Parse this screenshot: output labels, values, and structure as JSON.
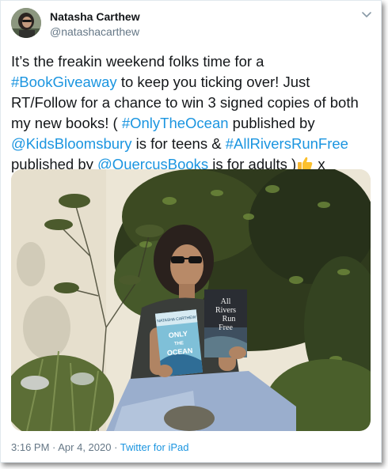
{
  "tweet": {
    "user": {
      "name": "Natasha Carthew",
      "handle": "@natashacarthew"
    },
    "lines": [
      [
        {
          "t": "It’s the freakin weekend folks time for a",
          "link": false
        }
      ],
      [
        {
          "t": "#BookGiveaway",
          "link": true
        },
        {
          "t": " to keep you ticking over! Just",
          "link": false
        }
      ],
      [
        {
          "t": "RT/Follow for a chance to win 3 signed copies of both",
          "link": false
        }
      ],
      [
        {
          "t": "my new books! ( ",
          "link": false
        },
        {
          "t": "#OnlyTheOcean",
          "link": true
        },
        {
          "t": " published by",
          "link": false
        }
      ],
      [
        {
          "t": "@KidsBloomsbury",
          "link": true
        },
        {
          "t": " is for teens & ",
          "link": false
        },
        {
          "t": "#AllRiversRunFree",
          "link": true
        }
      ],
      [
        {
          "t": " published by ",
          "link": false
        },
        {
          "t": "@QuercusBooks",
          "link": true
        },
        {
          "t": " is for adults )",
          "link": false
        },
        {
          "emoji": "thumbs-up-emoji"
        },
        {
          "t": " x",
          "link": false
        }
      ]
    ],
    "photo": {
      "book_left": {
        "author": "NATASHA CARTHEW",
        "title_lines": [
          "ONLY",
          "THE",
          "OCEAN"
        ]
      },
      "book_right": {
        "title_lines": [
          "All",
          "Rivers",
          "Run",
          "Free"
        ]
      }
    },
    "timestamp": "3:16 PM · Apr 4, 2020 · ",
    "source": "Twitter for iPad"
  },
  "colors": {
    "link": "#1b95e0",
    "text": "#14171a",
    "muted": "#657786"
  }
}
